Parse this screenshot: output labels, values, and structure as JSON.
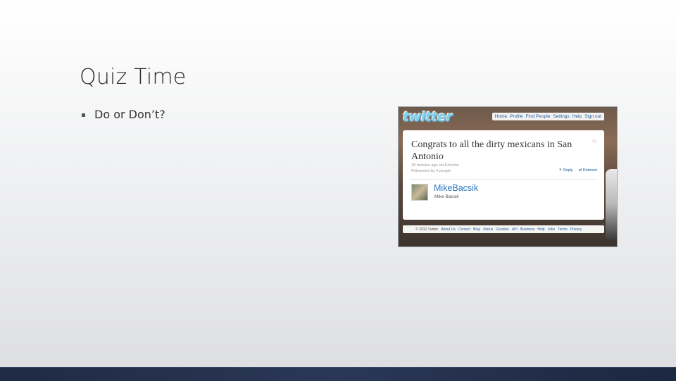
{
  "slide": {
    "title": "Quiz Time",
    "bullets": [
      "Do or Don’t?"
    ]
  },
  "tweet": {
    "logo": "twitter",
    "nav": [
      "Home",
      "Profile",
      "Find People",
      "Settings",
      "Help",
      "Sign out"
    ],
    "text": "Congrats to all the dirty mexicans in San Antonio",
    "meta_time": "28 minutes ago via Echofon",
    "meta_retweet": "Retweeted by 4 people",
    "reply_label": "Reply",
    "retweet_label": "Retweet",
    "username": "MikeBacsik",
    "real_name": "Mike Bacsik",
    "footer": [
      "© 2010 Twitter",
      "About Us",
      "Contact",
      "Blog",
      "Status",
      "Goodies",
      "API",
      "Business",
      "Help",
      "Jobs",
      "Terms",
      "Privacy"
    ]
  },
  "colors": {
    "footer_bar": "#24304c",
    "twitter_link": "#2d76b9"
  }
}
